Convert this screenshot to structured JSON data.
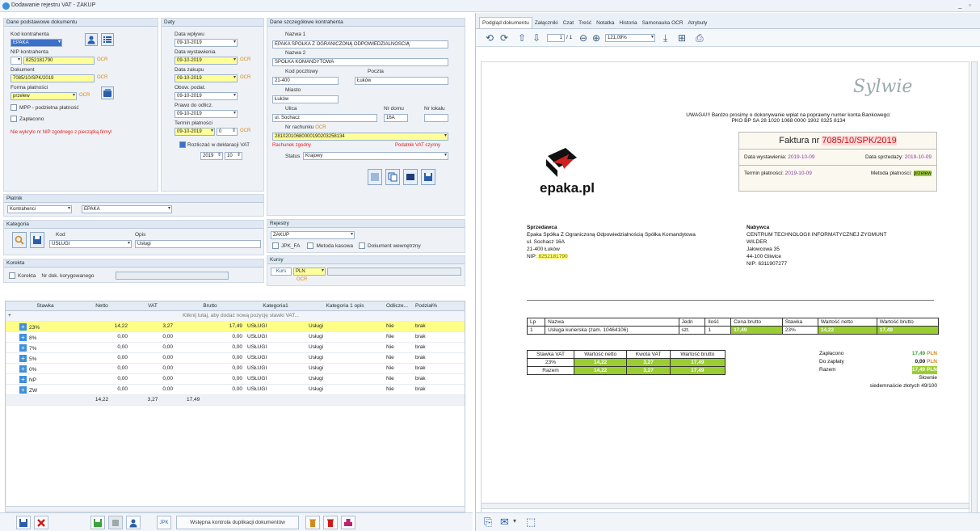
{
  "window": {
    "title": "Dodawanie rejestru VAT - ZAKUP",
    "min": "_",
    "max": "▫"
  },
  "sections": {
    "basic": "Dane podstawowe dokumentu",
    "dates": "Daty",
    "contractor": "Dane szczegółowe kontrahenta",
    "payer": "Płatnik",
    "category": "Kategoria",
    "correction": "Korekta",
    "registers": "Rejestry",
    "rates": "Kursy"
  },
  "basic": {
    "kod_label": "Kod kontrahenta",
    "kod_value": "EPAKA",
    "nip_label": "NIP kontrahenta",
    "nip_value": "8252181790",
    "ocr": "OCR",
    "doc_label": "Dokument",
    "doc_value": "7085/10/SPK/2019",
    "pay_label": "Forma płatności",
    "pay_value": "przelew",
    "mpp_label": "MPP - podzielna płatność",
    "paid_label": "Zapłacono",
    "warning": "Nie wykryto nr NIP zgodnego z pieczątką firmy!"
  },
  "dates": {
    "wplywu_label": "Data wpływu",
    "wplywu": "09-10-2019",
    "wyst_label": "Data wystawienia",
    "wyst": "09-10-2019",
    "zakupu_label": "Data zakupu",
    "zakupu": "09-10-2019",
    "obow_label": "Obow. podat.",
    "obow": "09-10-2019",
    "prawo_label": "Prawo do odlicz.",
    "prawo": "09-10-2019",
    "termin_label": "Termin płatności",
    "termin": "09-10-2019",
    "termin_days": "0",
    "vat_label": "Rozliczać w deklaracji VAT",
    "year": "2019",
    "month": "10"
  },
  "contractor": {
    "n1_label": "Nazwa 1",
    "n1": "EPAKA SPÓŁKA Z OGRANICZONĄ ODPOWIEDZIALNOŚCIĄ",
    "n2_label": "Nazwa 2",
    "n2": "SPÓŁKA KOMANDYTOWA",
    "kod_label": "Kod pocztowy",
    "kod": "21-400",
    "poczta_label": "Poczta",
    "poczta": "Łuków",
    "miasto_label": "Miasto",
    "miasto": "Łuków",
    "ulica_label": "Ulica",
    "ulica": "ul. Sochacz",
    "dom_label": "Nr domu",
    "dom": "16A",
    "lokal_label": "Nr lokalu",
    "rach_label": "Nr rachunku",
    "rach_ocr": "OCR",
    "rach": "28102010680000190203258134",
    "rach_ok": "Rachunek zgodny",
    "vat_ok": "Podatnik VAT czynny",
    "status_label": "Status",
    "status": "Krajowy"
  },
  "payer": {
    "type": "Kontrahenci",
    "name": "EPAKA"
  },
  "category": {
    "kod_label": "Kod",
    "kod": "USŁUGI",
    "opis_label": "Opis",
    "opis": "Usługi"
  },
  "correction": {
    "label": "Korekta",
    "nr_label": "Nr dok. korygowanego"
  },
  "registers": {
    "value": "ZAKUP",
    "jpk": "JPK_FA",
    "kasowa": "Metoda kasowa",
    "wewn": "Dokument wewnętrzny"
  },
  "rates": {
    "kurs": "Kurs",
    "currency": "PLN",
    "ocr": "OCR"
  },
  "grid": {
    "headers": [
      "Stawka",
      "Netto",
      "VAT",
      "Brutto",
      "Kategoria1",
      "Kategoria 1 opis",
      "Odlicze...",
      "Podział%"
    ],
    "hint": "Kliknij tutaj, aby dodać nową pozycję stawki VAT...",
    "rows": [
      [
        "23%",
        "14,22",
        "3,27",
        "17,49",
        "USŁUGI",
        "Usługi",
        "Nie",
        "brak"
      ],
      [
        "8%",
        "0,00",
        "0,00",
        "0,00",
        "USŁUGI",
        "Usługi",
        "Nie",
        "brak"
      ],
      [
        "7%",
        "0,00",
        "0,00",
        "0,00",
        "USŁUGI",
        "Usługi",
        "Nie",
        "brak"
      ],
      [
        "5%",
        "0,00",
        "0,00",
        "0,00",
        "USŁUGI",
        "Usługi",
        "Nie",
        "brak"
      ],
      [
        "0%",
        "0,00",
        "0,00",
        "0,00",
        "USŁUGI",
        "Usługi",
        "Nie",
        "brak"
      ],
      [
        "NP",
        "0,00",
        "0,00",
        "0,00",
        "USŁUGI",
        "Usługi",
        "Nie",
        "brak"
      ],
      [
        "ZW",
        "0,00",
        "0,00",
        "0,00",
        "USŁUGI",
        "Usługi",
        "Nie",
        "brak"
      ]
    ],
    "totals": [
      "14,22",
      "3,27",
      "17,49"
    ]
  },
  "buttons": {
    "jpk": "JPK",
    "dup": "Wstępna kontrola duplikacji dokumentów"
  },
  "tabs": [
    "Podgląd dokumentu",
    "Załączniki",
    "Czat",
    "Treść",
    "Notatka",
    "Historia",
    "Samonauka OCR",
    "Atrybuty"
  ],
  "viewer": {
    "page": "1",
    "pages": "/ 1",
    "zoom": "121,09%"
  },
  "invoice": {
    "signature": "Sylwie",
    "notice1": "UWAGA!!! Bardzo prosimy o dokonywanie wpłat na poprawny numer konta Bankowego:",
    "notice2": "PKO BP SA 28 1020 1068 0000 1902 0325 8134",
    "title_pre": "Faktura nr ",
    "number": "7085/10/SPK/2019",
    "wyst_label": "Data wystawienia:",
    "wyst": "2019-10-09",
    "sprz_label": "Data sprzedaży:",
    "sprz": "2019-10-09",
    "term_label": "Termin płatności:",
    "term": "2019-10-09",
    "met_label": "Metoda płatności:",
    "met": "przelew",
    "brand": "epaka.pl",
    "seller_h": "Sprzedawca",
    "seller": [
      "Epaka Spółka Z Ograniczoną Odpowiedzialnością Spółka Komandytowa",
      "ul. Sochacz 16A",
      "21-400 Łuków"
    ],
    "seller_nip_label": "NIP: ",
    "seller_nip": "8252181790",
    "buyer_h": "Nabywca",
    "buyer": [
      "CENTRUM TECHNOLOGII INFORMATYCZNEJ ZYGMUNT",
      "WILDER",
      "Jałowcowa 35",
      "44-100 Gliwice",
      "NIP: 6311907277"
    ],
    "items_head": [
      "Lp",
      "Nazwa",
      "Jedn",
      "Ilość",
      "Cena brutto",
      "Stawka",
      "Wartość netto",
      "Wartość brutto"
    ],
    "item": [
      "1",
      "Usługa kurierska (zam. 10464106)",
      "szt.",
      "1",
      "17,49",
      "23%",
      "14,22",
      "17,49"
    ],
    "vat_head": [
      "Stawka VAT",
      "Wartość netto",
      "Kwota VAT",
      "Wartość brutto"
    ],
    "vat_row": [
      "23%",
      "14,22",
      "3,27",
      "17,49"
    ],
    "vat_sum": [
      "Razem",
      "14,22",
      "3,27",
      "17,49"
    ],
    "paid_label": "Zapłacono",
    "paid": "17,49",
    "due_label": "Do zapłaty",
    "due": "0,00",
    "sum_label": "Razem",
    "sum": "17,49",
    "cur": "PLN",
    "words_label": "Słownie",
    "words": "siedemnaście złotych 49/100"
  }
}
